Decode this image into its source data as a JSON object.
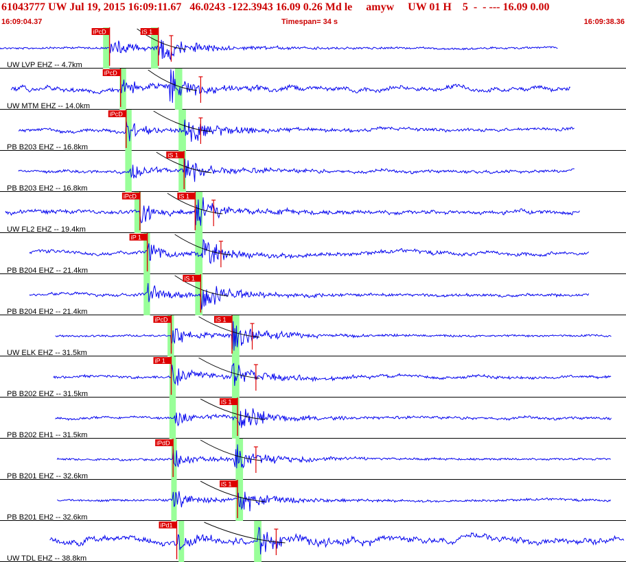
{
  "header": {
    "title": "61043777 UW Jul 19, 2015 16:09:11.67   46.0243 -122.3943 16.09 0.26 Md le     amyw     UW 01 H    5  -  - --- 16.09 0.00",
    "start_time": "16:09:04.37",
    "timespan": "Timespan=  34 s",
    "end_time": "16:09:38.36"
  },
  "colors": {
    "trace": "#0000ee",
    "pick": "#dd0000",
    "pick_window": "#99ff99",
    "label": "#000000",
    "header": "#cc0000"
  },
  "panels": [
    {
      "label": "UW LVP EHZ -- 4.7km",
      "p_pick": "iPcD",
      "s_pick": "iS 1",
      "p_time": 5.95,
      "s_time": 8.6,
      "amp_time": 9.3,
      "p_window": [
        5.6,
        5.95
      ],
      "s_window": [
        8.2,
        8.6
      ],
      "signal_start": 0.0,
      "signal_end": 30.3,
      "noise": 0.05
    },
    {
      "label": "UW MTM EHZ -- 14.0km",
      "p_pick": "iPcD",
      "s_pick": "",
      "p_time": 6.55,
      "s_time": 9.2,
      "amp_time": 10.9,
      "p_window": [
        6.5,
        6.85
      ],
      "s_window": [
        9.5,
        9.9
      ],
      "signal_start": 0.6,
      "signal_end": 31.0,
      "noise": 0.25
    },
    {
      "label": "PB B203 EHZ -- 16.8km",
      "p_pick": "iPcD",
      "s_pick": "",
      "p_time": 6.85,
      "s_time": 10.0,
      "amp_time": 10.9,
      "p_window": [
        6.8,
        7.15
      ],
      "s_window": [
        9.7,
        10.1
      ],
      "signal_start": 1.0,
      "signal_end": 31.2,
      "noise": 0.15
    },
    {
      "label": "PB B203 EH2 -- 16.8km",
      "p_pick": "",
      "s_pick": "iS 1",
      "p_time": 7.0,
      "s_time": 10.0,
      "amp_time": 0,
      "p_window": [
        6.8,
        7.15
      ],
      "s_window": [
        9.7,
        10.1
      ],
      "signal_start": 1.0,
      "signal_end": 31.2,
      "noise": 0.12
    },
    {
      "label": "UW FL2 EHZ -- 19.4km",
      "p_pick": "iPcD",
      "s_pick": "iS 1",
      "p_time": 7.6,
      "s_time": 10.6,
      "amp_time": 11.6,
      "p_window": [
        7.3,
        7.65
      ],
      "s_window": [
        10.6,
        11.0
      ],
      "signal_start": 0.3,
      "signal_end": 31.5,
      "noise": 0.2
    },
    {
      "label": "PB B204 EHZ -- 21.4km",
      "p_pick": "iP 1",
      "s_pick": "",
      "p_time": 8.0,
      "s_time": 11.0,
      "amp_time": 12.0,
      "p_window": [
        7.8,
        8.15
      ],
      "s_window": [
        10.6,
        11.0
      ],
      "signal_start": 1.6,
      "signal_end": 32.0,
      "noise": 0.18
    },
    {
      "label": "PB B204 EH2 -- 21.4km",
      "p_pick": "",
      "s_pick": "iS 1",
      "p_time": 8.0,
      "s_time": 10.9,
      "amp_time": 0,
      "p_window": [
        7.8,
        8.15
      ],
      "s_window": [
        10.6,
        11.0
      ],
      "signal_start": 1.6,
      "signal_end": 32.0,
      "noise": 0.13
    },
    {
      "label": "UW ELK EHZ -- 31.5km",
      "p_pick": "iPcD",
      "s_pick": "iS 1",
      "p_time": 9.3,
      "s_time": 12.6,
      "amp_time": 13.7,
      "p_window": [
        9.1,
        9.45
      ],
      "s_window": [
        12.6,
        13.0
      ],
      "signal_start": 3.0,
      "signal_end": 33.2,
      "noise": 0.05
    },
    {
      "label": "PB B202 EHZ -- 31.5km",
      "p_pick": "iP 1",
      "s_pick": "",
      "p_time": 9.3,
      "s_time": 12.6,
      "amp_time": 13.9,
      "p_window": [
        9.2,
        9.55
      ],
      "s_window": [
        12.6,
        13.0
      ],
      "signal_start": 2.9,
      "signal_end": 33.2,
      "noise": 0.12
    },
    {
      "label": "PB B202 EH1 -- 31.5km",
      "p_pick": "",
      "s_pick": "iS 1",
      "p_time": 9.4,
      "s_time": 12.9,
      "amp_time": 0,
      "p_window": [
        9.2,
        9.55
      ],
      "s_window": [
        12.6,
        13.0
      ],
      "signal_start": 3.0,
      "signal_end": 33.2,
      "noise": 0.1
    },
    {
      "label": "PB B201 EHZ -- 32.6km",
      "p_pick": "iPdD",
      "s_pick": "",
      "p_time": 9.4,
      "s_time": 12.7,
      "amp_time": 13.9,
      "p_window": [
        9.3,
        9.6
      ],
      "s_window": [
        12.8,
        13.2
      ],
      "signal_start": 3.1,
      "signal_end": 33.2,
      "noise": 0.06
    },
    {
      "label": "PB B201 EH2 -- 32.6km",
      "p_pick": "",
      "s_pick": "iS 1",
      "p_time": 9.4,
      "s_time": 12.9,
      "amp_time": 0,
      "p_window": [
        9.3,
        9.6
      ],
      "s_window": [
        12.8,
        13.2
      ],
      "signal_start": 3.1,
      "signal_end": 33.2,
      "noise": 0.07
    },
    {
      "label": "UW TDL EHZ -- 38.8km",
      "p_pick": "iPd1",
      "s_pick": "",
      "p_time": 9.6,
      "s_time": 14.0,
      "amp_time": 15.0,
      "p_window": [
        9.7,
        10.0
      ],
      "s_window": [
        13.8,
        14.2
      ],
      "signal_start": 2.7,
      "signal_end": 33.9,
      "noise": 0.35
    }
  ],
  "timespan_seconds": 34
}
